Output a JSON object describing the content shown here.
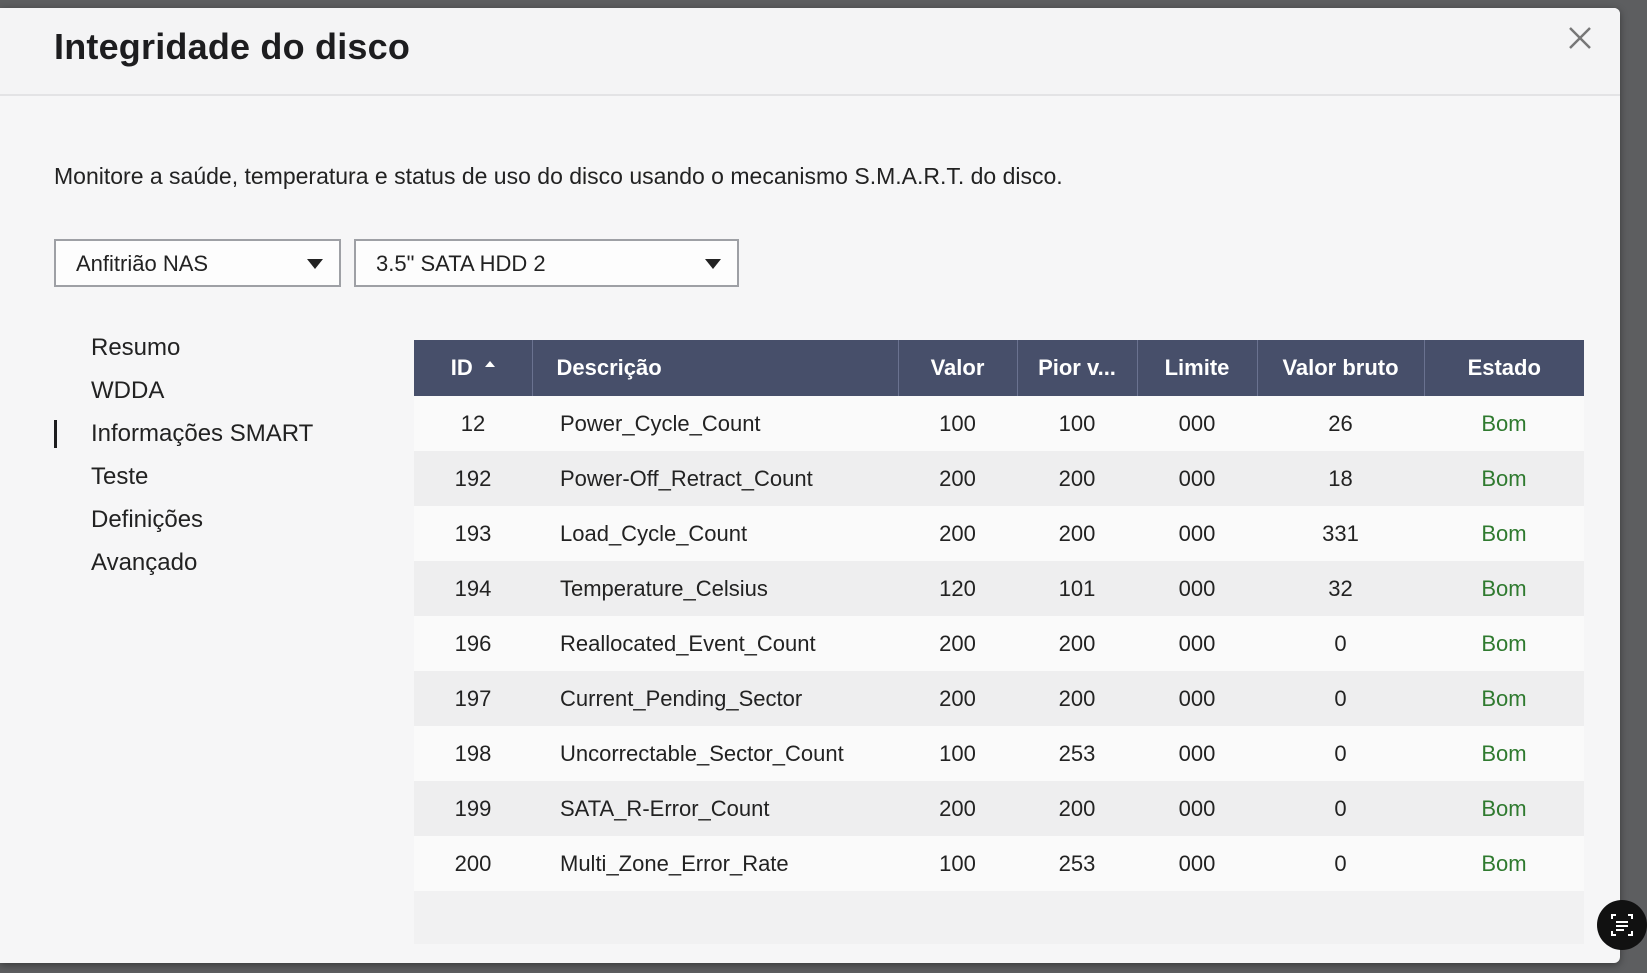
{
  "dialog": {
    "title": "Integridade do disco",
    "description": "Monitore a saúde, temperatura e status de uso do disco usando o mecanismo S.M.A.R.T. do disco."
  },
  "selectors": {
    "host": "Anfitrião NAS",
    "disk": "3.5\" SATA HDD 2"
  },
  "nav": {
    "items": [
      {
        "label": "Resumo"
      },
      {
        "label": "WDDA"
      },
      {
        "label": "Informações SMART",
        "active": true
      },
      {
        "label": "Teste"
      },
      {
        "label": "Definições"
      },
      {
        "label": "Avançado"
      }
    ]
  },
  "table": {
    "headers": {
      "id": "ID",
      "description": "Descrição",
      "value": "Valor",
      "worst": "Pior v...",
      "threshold": "Limite",
      "raw": "Valor bruto",
      "status": "Estado"
    },
    "rows": [
      {
        "id": "12",
        "description": "Power_Cycle_Count",
        "value": "100",
        "worst": "100",
        "threshold": "000",
        "raw": "26",
        "status": "Bom"
      },
      {
        "id": "192",
        "description": "Power-Off_Retract_Count",
        "value": "200",
        "worst": "200",
        "threshold": "000",
        "raw": "18",
        "status": "Bom"
      },
      {
        "id": "193",
        "description": "Load_Cycle_Count",
        "value": "200",
        "worst": "200",
        "threshold": "000",
        "raw": "331",
        "status": "Bom"
      },
      {
        "id": "194",
        "description": "Temperature_Celsius",
        "value": "120",
        "worst": "101",
        "threshold": "000",
        "raw": "32",
        "status": "Bom"
      },
      {
        "id": "196",
        "description": "Reallocated_Event_Count",
        "value": "200",
        "worst": "200",
        "threshold": "000",
        "raw": "0",
        "status": "Bom"
      },
      {
        "id": "197",
        "description": "Current_Pending_Sector",
        "value": "200",
        "worst": "200",
        "threshold": "000",
        "raw": "0",
        "status": "Bom"
      },
      {
        "id": "198",
        "description": "Uncorrectable_Sector_Count",
        "value": "100",
        "worst": "253",
        "threshold": "000",
        "raw": "0",
        "status": "Bom"
      },
      {
        "id": "199",
        "description": "SATA_R-Error_Count",
        "value": "200",
        "worst": "200",
        "threshold": "000",
        "raw": "0",
        "status": "Bom"
      },
      {
        "id": "200",
        "description": "Multi_Zone_Error_Rate",
        "value": "100",
        "worst": "253",
        "threshold": "000",
        "raw": "0",
        "status": "Bom"
      }
    ]
  },
  "colors": {
    "header_bg": "#474f6a",
    "status_good": "#2f7a2f"
  },
  "icons": {
    "close": "close-icon",
    "sort": "sort-ascending-icon",
    "dropdown": "chevron-down-icon",
    "floating": "scan-text-icon"
  }
}
